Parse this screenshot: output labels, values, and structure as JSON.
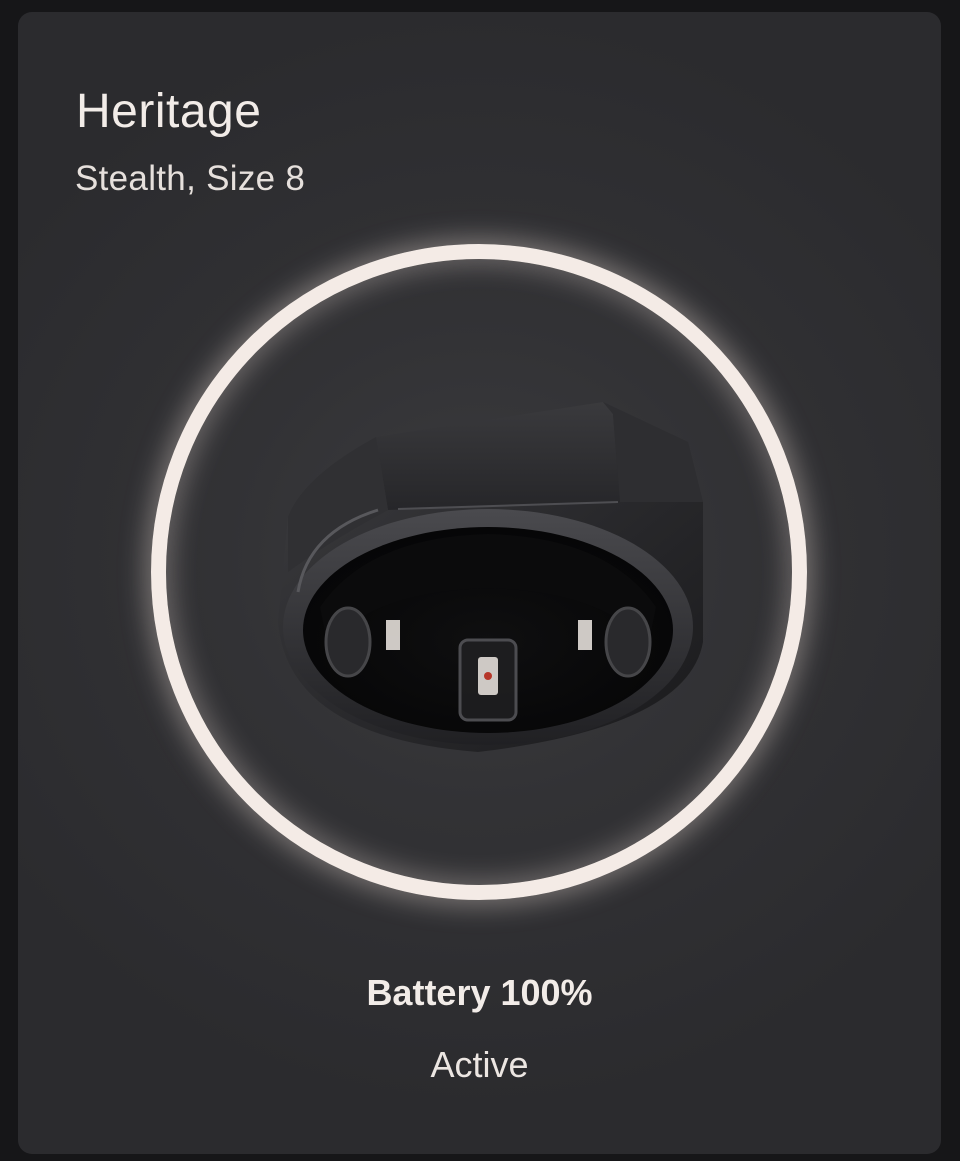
{
  "device": {
    "name": "Heritage",
    "variant": "Stealth, Size 8",
    "battery_label": "Battery 100%",
    "battery_level": 100,
    "status": "Active"
  },
  "image": {
    "icon": "smart-ring-image"
  },
  "colors": {
    "background": "#161618",
    "card": "#2f2f32",
    "halo": "#f4ebe6",
    "text": "#f2ece8"
  }
}
